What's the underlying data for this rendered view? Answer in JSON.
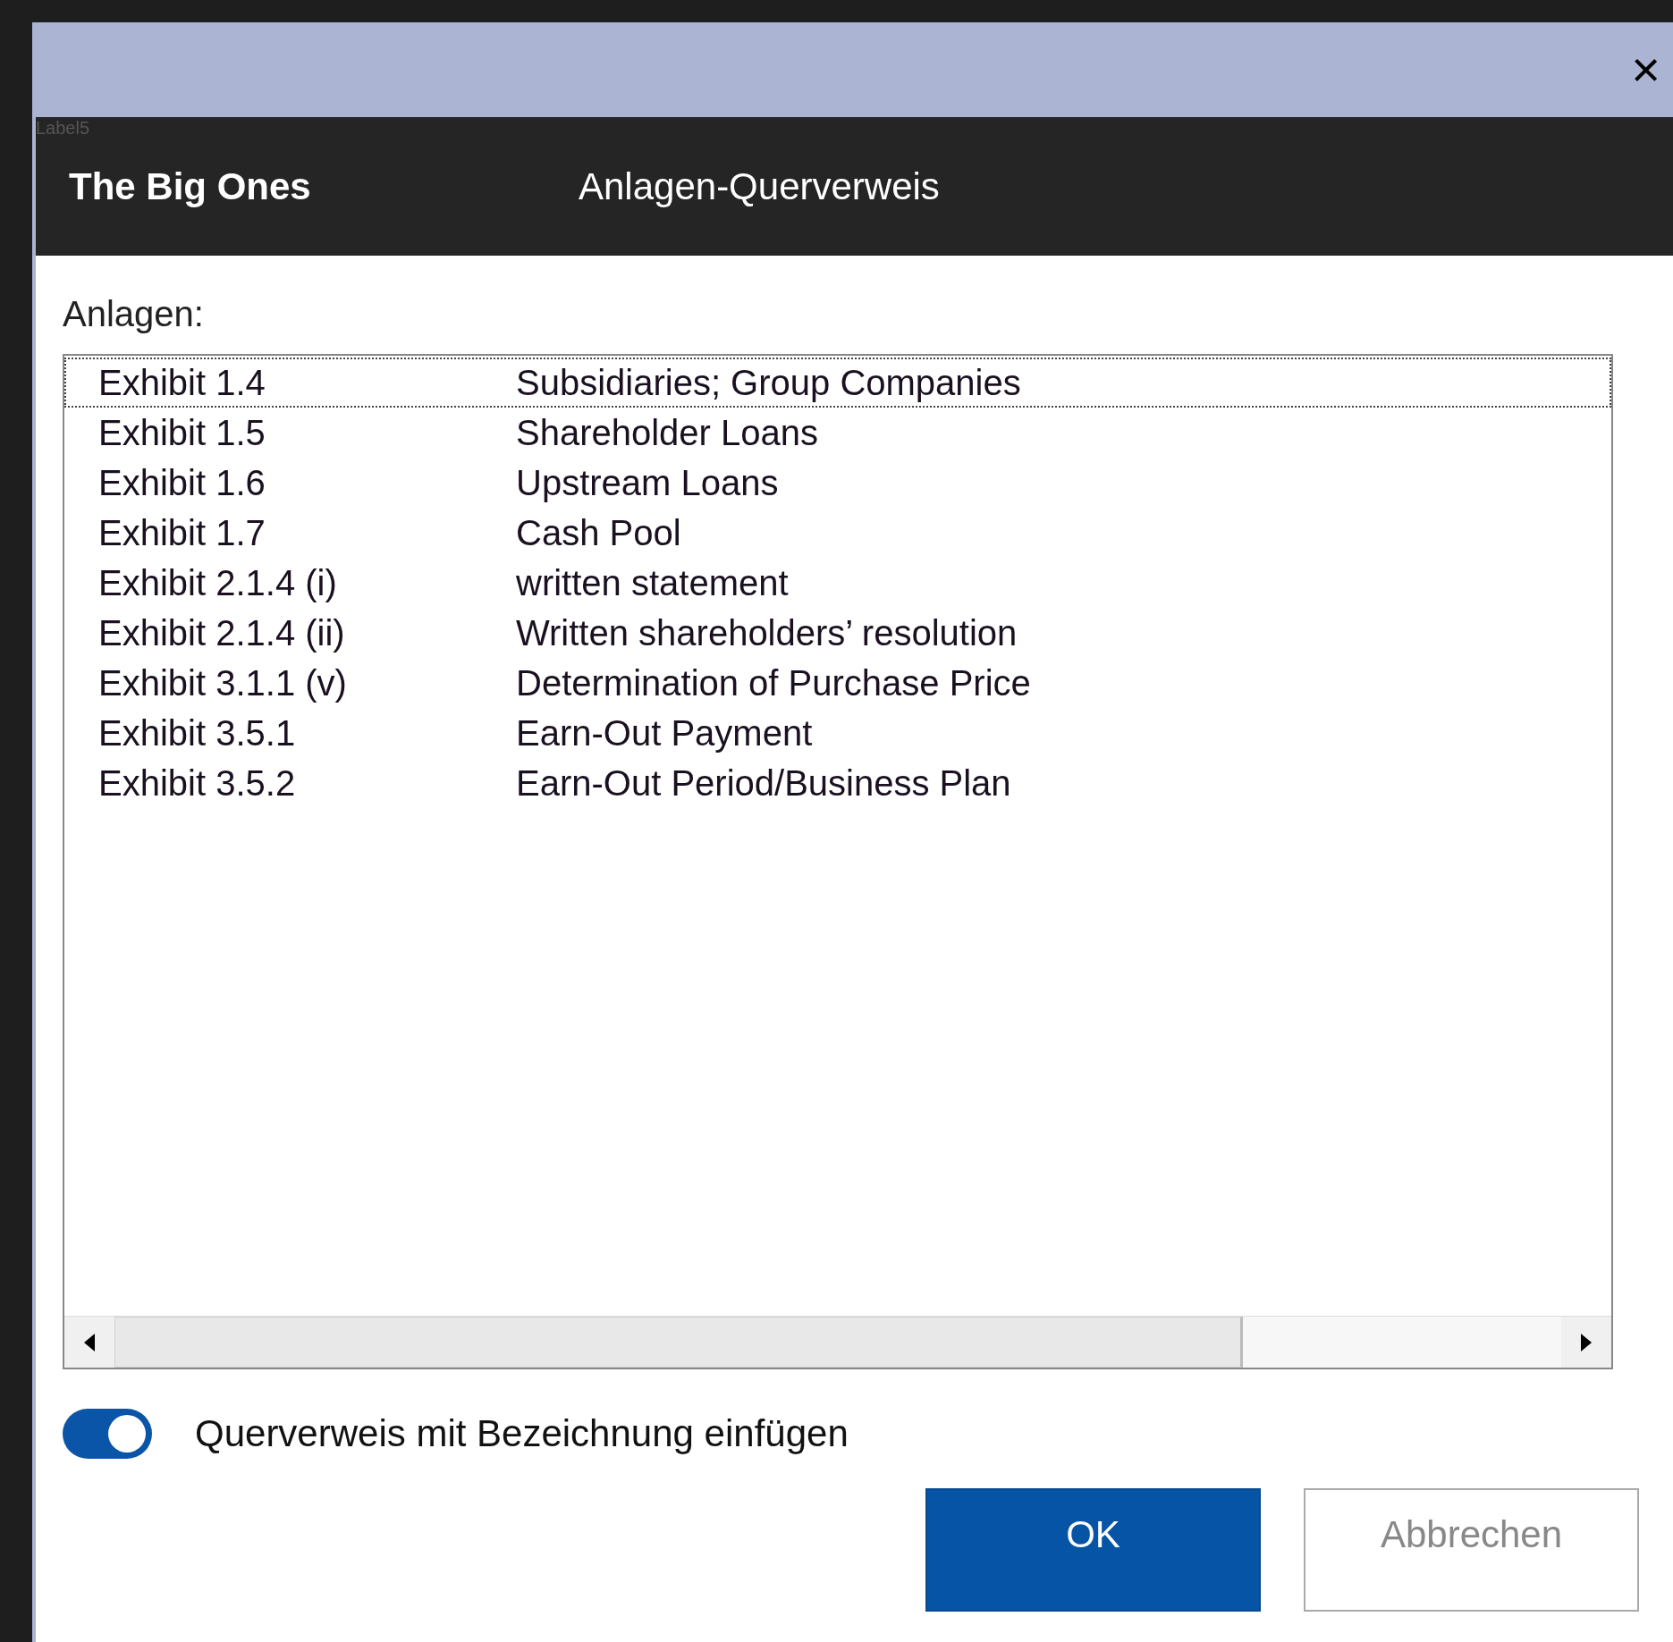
{
  "window": {
    "close": "×"
  },
  "header": {
    "clipped_label": "Label5",
    "brand": "The Big Ones",
    "title": "Anlagen-Querverweis"
  },
  "list": {
    "label": "Anlagen:",
    "rows": [
      {
        "exhibit": "Exhibit 1.4",
        "description": "Subsidiaries; Group Companies",
        "focused": true
      },
      {
        "exhibit": "Exhibit 1.5",
        "description": "Shareholder Loans",
        "focused": false
      },
      {
        "exhibit": "Exhibit 1.6",
        "description": "Upstream Loans",
        "focused": false
      },
      {
        "exhibit": "Exhibit 1.7",
        "description": "Cash Pool",
        "focused": false
      },
      {
        "exhibit": "Exhibit 2.1.4 (i)",
        "description": "written statement",
        "focused": false
      },
      {
        "exhibit": "Exhibit 2.1.4 (ii)",
        "description": "Written shareholders’ resolution",
        "focused": false
      },
      {
        "exhibit": "Exhibit 3.1.1 (v)",
        "description": "Determination of Purchase Price",
        "focused": false
      },
      {
        "exhibit": "Exhibit 3.5.1",
        "description": "Earn-Out Payment",
        "focused": false
      },
      {
        "exhibit": "Exhibit 3.5.2",
        "description": "Earn-Out Period/Business Plan",
        "focused": false
      }
    ]
  },
  "toggle": {
    "label": "Querverweis mit Bezeichnung einfügen",
    "on": true
  },
  "buttons": [
    {
      "label": "OK",
      "kind": "primary"
    },
    {
      "label": "Abbrechen",
      "kind": "secondary"
    }
  ]
}
